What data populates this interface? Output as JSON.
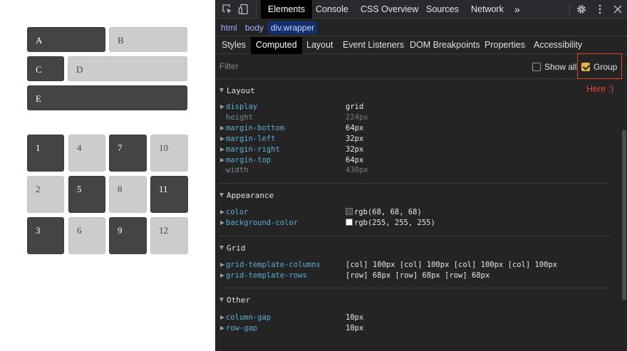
{
  "demo": {
    "top_boxes": [
      "A",
      "B",
      "C",
      "D",
      "E"
    ],
    "grid_items": [
      "1",
      "4",
      "7",
      "10",
      "2",
      "5",
      "8",
      "11",
      "3",
      "6",
      "9",
      "12"
    ],
    "colors": {
      "dark": "#444444",
      "light": "#cccccc"
    }
  },
  "toolbar": {
    "tabs": [
      "Elements",
      "Console",
      "CSS Overview",
      "Sources",
      "Network"
    ],
    "more_label": "»",
    "inspect_icon": "inspect-element-icon",
    "device_icon": "device-toolbar-icon",
    "settings_icon": "gear-icon",
    "menu_icon": "kebab-menu-icon",
    "close_icon": "close-icon"
  },
  "breadcrumb": [
    "html",
    "body",
    "div.wrapper"
  ],
  "subtabs": [
    "Styles",
    "Computed",
    "Layout",
    "Event Listeners",
    "DOM Breakpoints",
    "Properties",
    "Accessibility"
  ],
  "filter": {
    "placeholder": "Filter",
    "show_all_label": "Show all",
    "show_all_checked": false,
    "group_label": "Group",
    "group_checked": true
  },
  "annotation": "Here :)",
  "sections": {
    "layout": {
      "title": "Layout",
      "props": [
        {
          "name": "display",
          "value": "grid"
        },
        {
          "name": "height",
          "value": "224px"
        },
        {
          "name": "margin-bottom",
          "value": "64px"
        },
        {
          "name": "margin-left",
          "value": "32px"
        },
        {
          "name": "margin-right",
          "value": "32px"
        },
        {
          "name": "margin-top",
          "value": "64px"
        },
        {
          "name": "width",
          "value": "430px"
        }
      ]
    },
    "appearance": {
      "title": "Appearance",
      "props": [
        {
          "name": "color",
          "value": "rgb(68, 68, 68)",
          "swatch": "#444444"
        },
        {
          "name": "background-color",
          "value": "rgb(255, 255, 255)",
          "swatch": "#ffffff"
        }
      ]
    },
    "grid": {
      "title": "Grid",
      "props": [
        {
          "name": "grid-template-columns",
          "value": "[col] 100px [col] 100px [col] 100px [col] 100px"
        },
        {
          "name": "grid-template-rows",
          "value": "[row] 68px [row] 68px [row] 68px"
        }
      ]
    },
    "other": {
      "title": "Other",
      "props": [
        {
          "name": "column-gap",
          "value": "10px"
        },
        {
          "name": "row-gap",
          "value": "10px"
        }
      ]
    }
  }
}
